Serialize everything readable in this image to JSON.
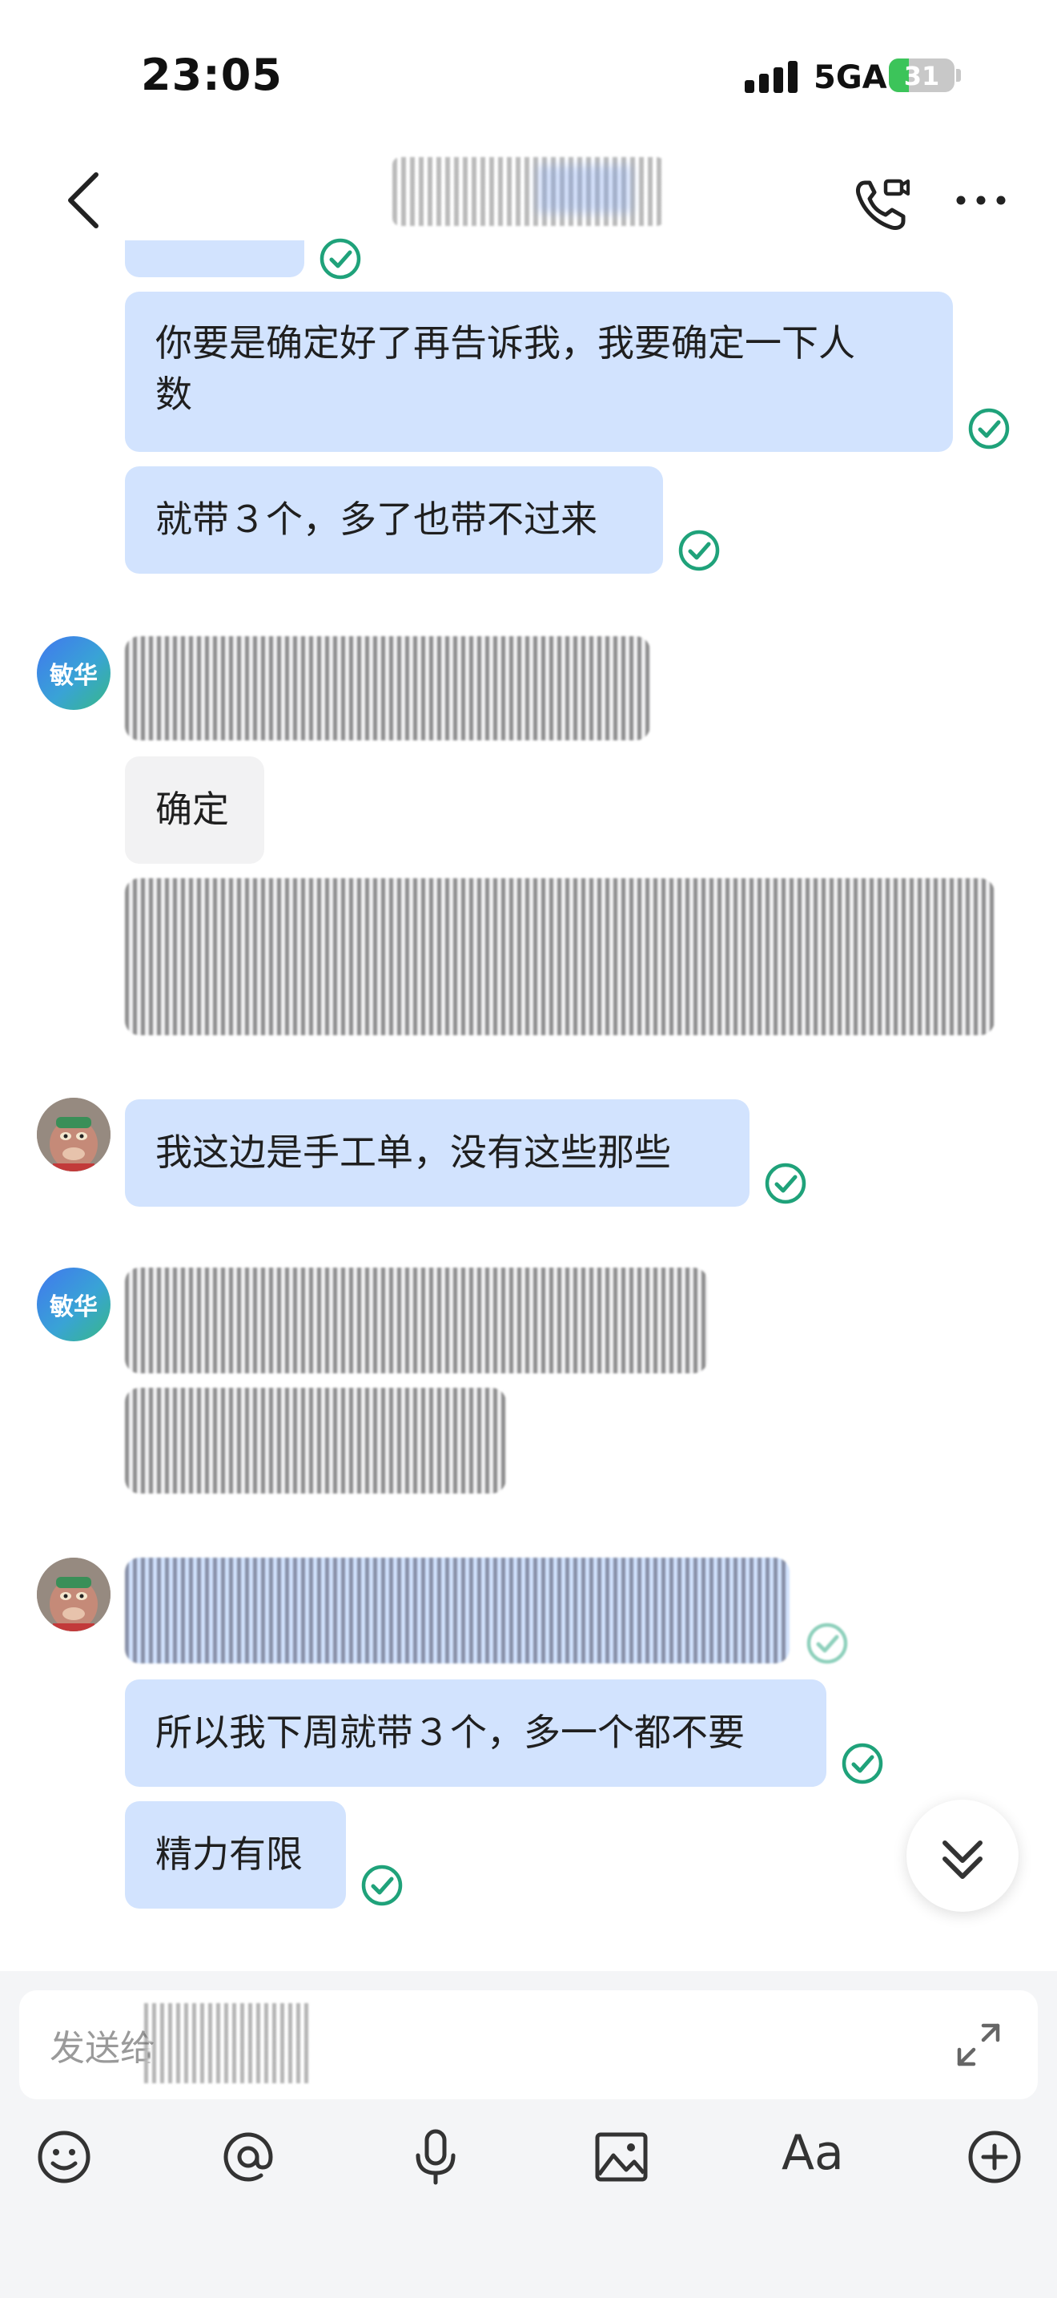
{
  "status_bar": {
    "time": "23:05",
    "network": "5GA",
    "battery": "31",
    "battery_level": 0.31
  },
  "header": {
    "icons": [
      "back-icon",
      "phone-call-icon",
      "more-icon"
    ]
  },
  "messages": [
    {
      "id": "m1",
      "direction": "out",
      "text": "你要是确定好了再告诉我，我要确定一下人数",
      "line1": "你要是确定好了再告诉我，我要确定一下人",
      "line2": "数",
      "status": "read"
    },
    {
      "id": "m2",
      "direction": "out",
      "text": "就带３个，多了也带不过来",
      "status": "read"
    },
    {
      "id": "m3",
      "direction": "in",
      "sender": "敏华",
      "text": "确定"
    },
    {
      "id": "m4",
      "direction": "out",
      "text": "我这边是手工单，没有这些那些",
      "status": "read"
    },
    {
      "id": "m5",
      "direction": "out",
      "text": "所以我下周就带３个，多一个都不要",
      "status": "read"
    },
    {
      "id": "m6",
      "direction": "out",
      "text": "精力有限",
      "status": "read"
    }
  ],
  "contact": {
    "name": "敏华"
  },
  "composer": {
    "placeholder": "发送给",
    "tools": [
      "emoji-icon",
      "mention-icon",
      "microphone-icon",
      "image-icon",
      "text-format-icon",
      "add-icon"
    ],
    "format_label": "Aa"
  },
  "colors": {
    "outgoing_bubble": "#d2e3fe",
    "incoming_bubble": "#f2f2f3",
    "read_tick": "#1fa27a"
  }
}
